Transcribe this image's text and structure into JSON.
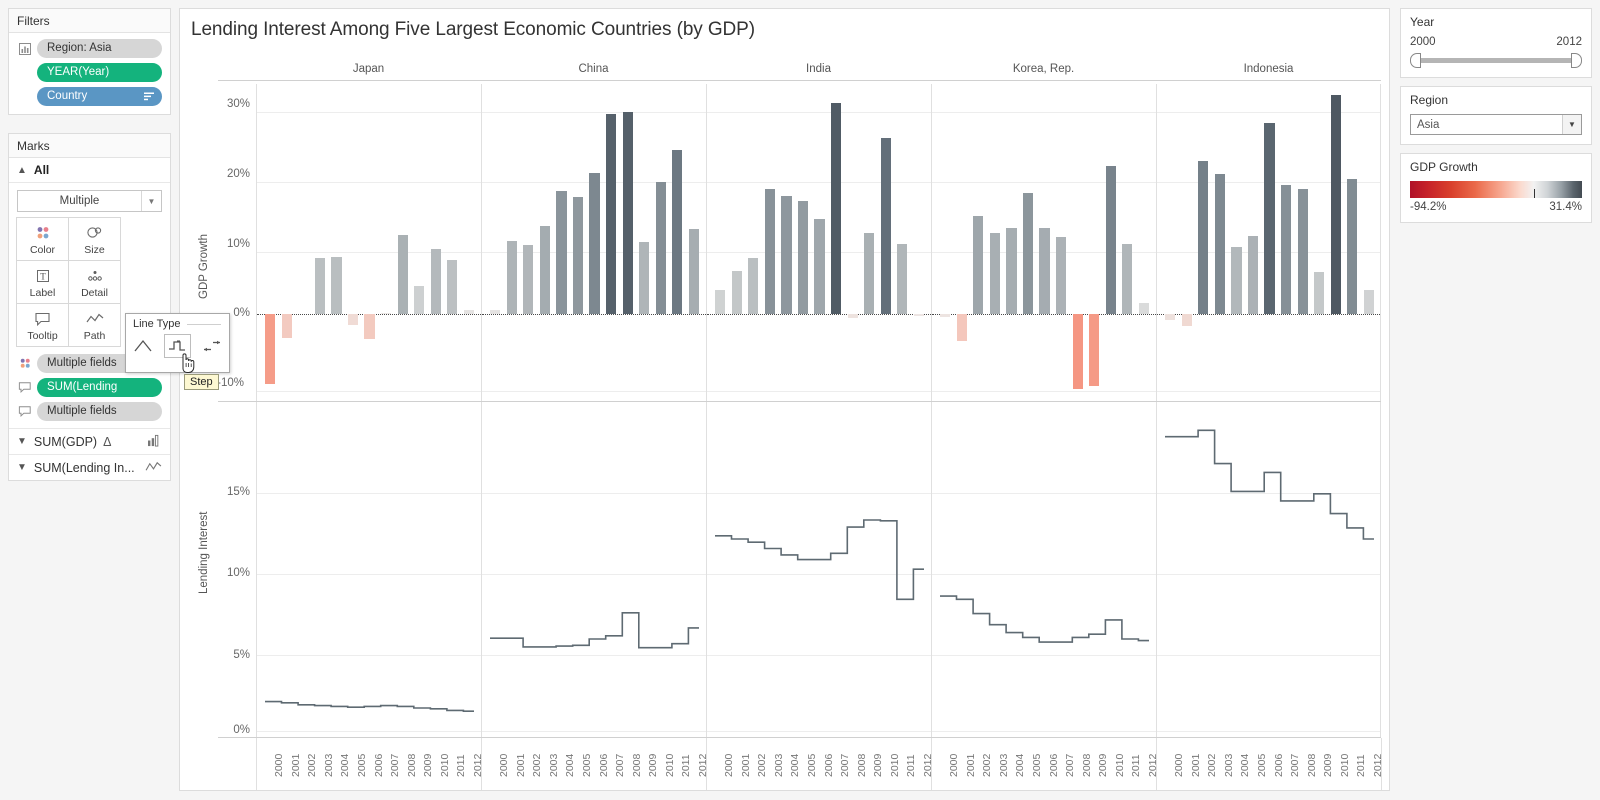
{
  "left_panel": {
    "filters": {
      "title": "Filters",
      "items": [
        {
          "label": "Region: Asia",
          "style": "grey",
          "icon": "filter-card-icon"
        },
        {
          "label": "YEAR(Year)",
          "style": "green",
          "icon": "none"
        },
        {
          "label": "Country",
          "style": "blue",
          "icon": "sort-icon"
        }
      ]
    },
    "marks": {
      "title": "Marks",
      "all_label": "All",
      "mark_type": "Multiple",
      "buttons": [
        {
          "label": "Color",
          "icon": "color-dots-icon"
        },
        {
          "label": "Size",
          "icon": "size-circles-icon"
        },
        {
          "label": "Label",
          "icon": "label-T-icon"
        },
        {
          "label": "Detail",
          "icon": "detail-dots-icon"
        },
        {
          "label": "Tooltip",
          "icon": "tooltip-bubble-icon"
        },
        {
          "label": "Path",
          "icon": "path-line-icon"
        }
      ],
      "pills": [
        {
          "label": "Multiple fields",
          "style": "grey",
          "icon": "color-dots-icon"
        },
        {
          "label": "SUM(Lending",
          "style": "green",
          "icon": "tooltip-bubble-icon"
        },
        {
          "label": "Multiple fields",
          "style": "grey",
          "icon": "tooltip-bubble-icon"
        }
      ]
    },
    "field_cards": [
      {
        "label": "SUM(GDP)",
        "symbol": "Δ",
        "right_icon": "bar-chart-icon"
      },
      {
        "label": "SUM(Lending In...",
        "symbol": "",
        "right_icon": "line-chart-icon"
      }
    ]
  },
  "popup": {
    "title": "Line Type",
    "options": [
      {
        "name": "linear",
        "selected": false
      },
      {
        "name": "step",
        "selected": true
      },
      {
        "name": "jump",
        "selected": false
      }
    ],
    "tooltip": "Step"
  },
  "right_panel": {
    "year_filter": {
      "title": "Year",
      "min": "2000",
      "max": "2012"
    },
    "region_filter": {
      "title": "Region",
      "value": "Asia"
    },
    "color_legend": {
      "title": "GDP Growth",
      "min": "-94.2%",
      "max": "31.4%"
    }
  },
  "viz": {
    "title": "Lending Interest Among Five Largest Economic Countries (by GDP)",
    "columns": [
      "Japan",
      "China",
      "India",
      "Korea, Rep.",
      "Indonesia"
    ],
    "top_axis_title": "GDP Growth",
    "bottom_axis_title": "Lending Interest",
    "top_ticks": [
      "30%",
      "20%",
      "10%",
      "0%",
      "-10%"
    ],
    "bottom_ticks": [
      "15%",
      "10%",
      "5%",
      "0%"
    ],
    "years": [
      "2000",
      "2001",
      "2002",
      "2003",
      "2004",
      "2005",
      "2006",
      "2007",
      "2008",
      "2009",
      "2010",
      "2011",
      "2012"
    ]
  },
  "chart_data": [
    {
      "type": "bar",
      "title": "GDP Growth",
      "ylabel": "GDP Growth",
      "xlabel": "",
      "ylim": [
        -12,
        33
      ],
      "grid": true,
      "categories": [
        "2000",
        "2001",
        "2002",
        "2003",
        "2004",
        "2005",
        "2006",
        "2007",
        "2008",
        "2009",
        "2010",
        "2011",
        "2012"
      ],
      "series": [
        {
          "name": "Japan",
          "values": [
            -10.0,
            -3.5,
            0.0,
            8.1,
            8.2,
            -1.5,
            -3.6,
            0.1,
            11.3,
            4.0,
            9.3,
            7.7,
            0.6
          ]
        },
        {
          "name": "China",
          "values": [
            0.6,
            10.5,
            9.9,
            12.6,
            17.6,
            16.8,
            20.3,
            28.7,
            29.0,
            10.3,
            18.9,
            23.5,
            12.2
          ]
        },
        {
          "name": "India",
          "values": [
            3.5,
            6.2,
            8.0,
            18.0,
            17.0,
            16.2,
            13.7,
            30.3,
            -0.6,
            11.6,
            25.2,
            10.0,
            -0.3
          ]
        },
        {
          "name": "Korea, Rep.",
          "values": [
            -0.4,
            -3.9,
            14.0,
            11.7,
            12.3,
            17.3,
            12.4,
            11.0,
            -10.8,
            -10.3,
            21.3,
            10.0,
            1.6
          ]
        },
        {
          "name": "Indonesia",
          "values": [
            -0.8,
            -1.7,
            22.0,
            20.1,
            9.6,
            11.2,
            27.4,
            18.5,
            18.0,
            6.0,
            31.4,
            19.4,
            3.4
          ]
        }
      ],
      "color_scale": {
        "min": "-94.2%",
        "max": "31.4%",
        "low_color": "#b01128",
        "high_color": "#434b52"
      }
    },
    {
      "type": "line",
      "line_type": "step",
      "title": "Lending Interest",
      "ylabel": "Lending Interest",
      "xlabel": "",
      "ylim": [
        0,
        20
      ],
      "grid": true,
      "categories": [
        "2000",
        "2001",
        "2002",
        "2003",
        "2004",
        "2005",
        "2006",
        "2007",
        "2008",
        "2009",
        "2010",
        "2011",
        "2012"
      ],
      "series": [
        {
          "name": "Japan",
          "values": [
            1.85,
            1.78,
            1.65,
            1.6,
            1.55,
            1.5,
            1.55,
            1.6,
            1.55,
            1.45,
            1.4,
            1.3,
            1.25
          ]
        },
        {
          "name": "China",
          "values": [
            5.85,
            5.85,
            5.3,
            5.3,
            5.35,
            5.4,
            5.8,
            6.0,
            7.45,
            5.25,
            5.25,
            5.5,
            6.5
          ]
        },
        {
          "name": "India",
          "values": [
            12.3,
            12.1,
            11.9,
            11.5,
            11.1,
            10.8,
            10.8,
            11.2,
            12.85,
            13.3,
            13.25,
            8.3,
            10.2
          ]
        },
        {
          "name": "Korea, Rep.",
          "values": [
            8.5,
            8.3,
            7.4,
            6.7,
            6.2,
            5.9,
            5.6,
            5.6,
            5.9,
            6.1,
            7.0,
            5.8,
            5.7
          ]
        },
        {
          "name": "Indonesia",
          "values": [
            18.55,
            18.55,
            18.95,
            16.85,
            15.1,
            15.1,
            16.3,
            14.5,
            14.5,
            14.95,
            13.7,
            12.8,
            12.1
          ]
        }
      ]
    }
  ]
}
